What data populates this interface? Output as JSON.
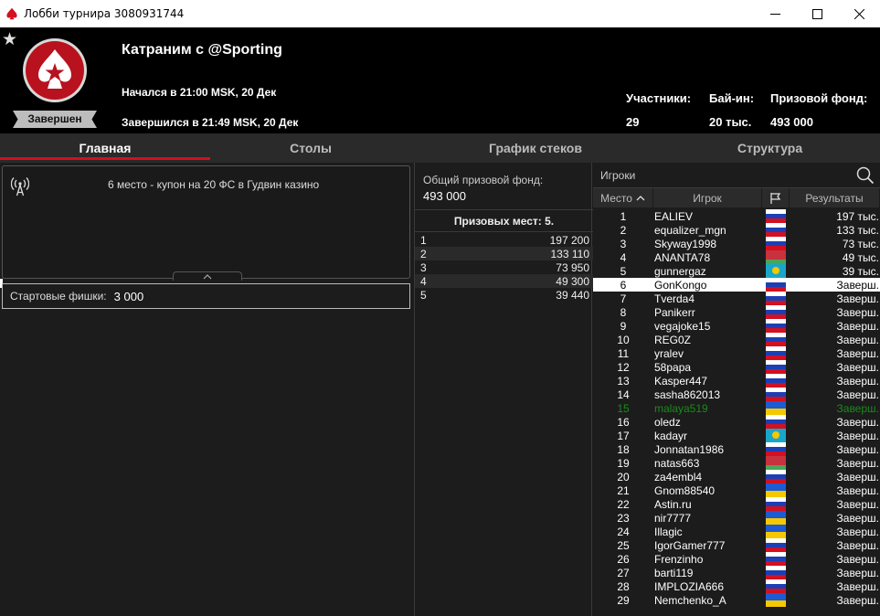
{
  "window": {
    "title": "Лобби турнира 3080931744"
  },
  "header": {
    "tournament_name": "Катраним с @Sporting",
    "started": "Начался в 21:00 MSK, 20 Дек",
    "ended": "Завершился в 21:49 MSK, 20 Дек",
    "status": "Завершен",
    "stats": [
      {
        "label": "Участники:",
        "value": "29"
      },
      {
        "label": "Бай-ин:",
        "value": "20 тыс."
      },
      {
        "label": "Призовой фонд:",
        "value": "493 000"
      }
    ]
  },
  "tabs": [
    {
      "label": "Главная",
      "active": true
    },
    {
      "label": "Столы",
      "active": false
    },
    {
      "label": "График стеков",
      "active": false
    },
    {
      "label": "Структура",
      "active": false
    }
  ],
  "info": {
    "announcement": "6 место - купон на 20 ФС в Гудвин казино",
    "starting_chips_label": "Стартовые фишки:",
    "starting_chips_value": "3 000"
  },
  "prizes": {
    "pool_label": "Общий призовой фонд:",
    "pool_value": "493 000",
    "places_label": "Призовых мест: 5.",
    "rows": [
      {
        "place": "1",
        "amount": "197 200"
      },
      {
        "place": "2",
        "amount": "133 110"
      },
      {
        "place": "3",
        "amount": "73 950"
      },
      {
        "place": "4",
        "amount": "49 300"
      },
      {
        "place": "5",
        "amount": "39 440"
      }
    ]
  },
  "players": {
    "search_placeholder": "Игроки",
    "columns": {
      "place": "Место",
      "player": "Игрок",
      "results": "Результаты"
    },
    "colors": {
      "selected_bg": "#ffffff",
      "highlight": "#1a8a1a"
    },
    "rows": [
      {
        "place": "1",
        "name": "EALIEV",
        "flag": "ru",
        "result": "197 тыс."
      },
      {
        "place": "2",
        "name": "equalizer_mgn",
        "flag": "ru",
        "result": "133 тыс."
      },
      {
        "place": "3",
        "name": "Skyway1998",
        "flag": "ru",
        "result": "73 тыс."
      },
      {
        "place": "4",
        "name": "ANANTA78",
        "flag": "by",
        "result": "49 тыс."
      },
      {
        "place": "5",
        "name": "gunnergaz",
        "flag": "kz",
        "result": "39 тыс."
      },
      {
        "place": "6",
        "name": "GonKongo",
        "flag": "ru",
        "result": "Заверш.",
        "selected": true
      },
      {
        "place": "7",
        "name": "Tverda4",
        "flag": "ru",
        "result": "Заверш."
      },
      {
        "place": "8",
        "name": "Panikerr",
        "flag": "ru",
        "result": "Заверш."
      },
      {
        "place": "9",
        "name": "vegajoke15",
        "flag": "ru",
        "result": "Заверш."
      },
      {
        "place": "10",
        "name": "REG0Z",
        "flag": "ru",
        "result": "Заверш."
      },
      {
        "place": "11",
        "name": "yralev",
        "flag": "ru",
        "result": "Заверш."
      },
      {
        "place": "12",
        "name": "58papa",
        "flag": "ru",
        "result": "Заверш."
      },
      {
        "place": "13",
        "name": "Kasper447",
        "flag": "ru",
        "result": "Заверш."
      },
      {
        "place": "14",
        "name": "sasha862013",
        "flag": "ru",
        "result": "Заверш."
      },
      {
        "place": "15",
        "name": "malaya519",
        "flag": "ua",
        "result": "Заверш.",
        "highlight": true
      },
      {
        "place": "16",
        "name": "oledz",
        "flag": "ru",
        "result": "Заверш."
      },
      {
        "place": "17",
        "name": "kadayr",
        "flag": "kz",
        "result": "Заверш."
      },
      {
        "place": "18",
        "name": "Jonnatan1986",
        "flag": "ru",
        "result": "Заверш."
      },
      {
        "place": "19",
        "name": "natas663",
        "flag": "by",
        "result": "Заверш."
      },
      {
        "place": "20",
        "name": "za4embl4",
        "flag": "ru",
        "result": "Заверш."
      },
      {
        "place": "21",
        "name": "Gnom88540",
        "flag": "ua",
        "result": "Заверш."
      },
      {
        "place": "22",
        "name": "Astin.ru",
        "flag": "ru",
        "result": "Заверш."
      },
      {
        "place": "23",
        "name": "nir7777",
        "flag": "ua",
        "result": "Заверш."
      },
      {
        "place": "24",
        "name": "Illagic",
        "flag": "ua",
        "result": "Заверш."
      },
      {
        "place": "25",
        "name": "IgorGamer777",
        "flag": "ru",
        "result": "Заверш."
      },
      {
        "place": "26",
        "name": "Frenzinho",
        "flag": "ru",
        "result": "Заверш."
      },
      {
        "place": "27",
        "name": "barti119",
        "flag": "ru",
        "result": "Заверш."
      },
      {
        "place": "28",
        "name": "IMPLOZIA666",
        "flag": "ru",
        "result": "Заверш."
      },
      {
        "place": "29",
        "name": "Nemchenko_A",
        "flag": "ua",
        "result": "Заверш."
      }
    ]
  }
}
